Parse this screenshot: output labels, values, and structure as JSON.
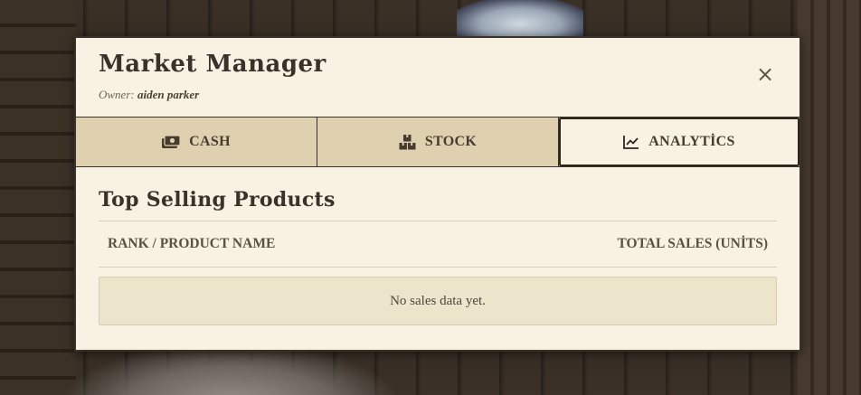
{
  "header": {
    "title": "Market Manager",
    "owner_label": "Owner:",
    "owner_name": "aiden parker",
    "close_label": "×"
  },
  "tabs": [
    {
      "label": "CASH",
      "icon": "money-icon",
      "active": false
    },
    {
      "label": "STOCK",
      "icon": "boxes-icon",
      "active": false
    },
    {
      "label": "ANALYTİCS",
      "icon": "chart-line-icon",
      "active": true
    }
  ],
  "analytics": {
    "section_title": "Top Selling Products",
    "columns": [
      "RANK / PRODUCT NAME",
      "TOTAL SALES (UNİTS)"
    ],
    "empty_message": "No sales data yet."
  },
  "colors": {
    "panel_bg": "#f7f2e1",
    "tab_bg": "#dfd1b0",
    "border": "#3a3128",
    "text": "#3a322a"
  }
}
